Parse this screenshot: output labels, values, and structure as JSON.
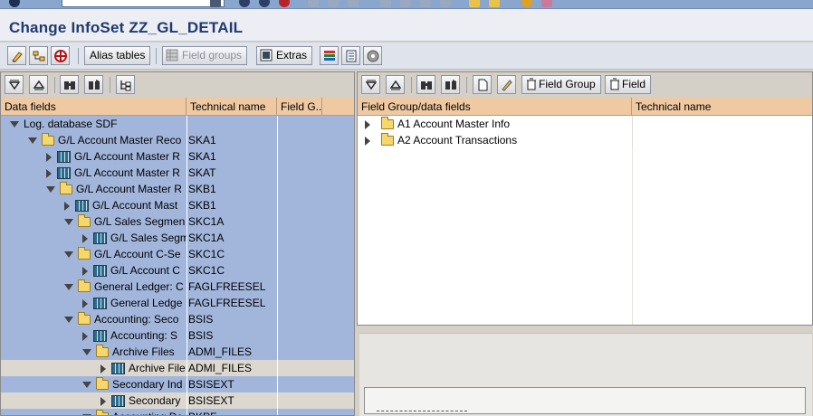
{
  "title": "Change InfoSet ZZ_GL_DETAIL",
  "app_toolbar": {
    "alias_tables": "Alias tables",
    "field_groups": "Field groups",
    "extras": "Extras"
  },
  "left": {
    "columns": [
      "Data fields",
      "Technical name",
      "Field G..."
    ],
    "rows": [
      {
        "indent": 0,
        "toggle": "down",
        "icon": "none",
        "label": "Log. database SDF",
        "tech": "",
        "style": "blue"
      },
      {
        "indent": 1,
        "toggle": "down",
        "icon": "folder",
        "label": "G/L Account Master Reco",
        "tech": "SKA1",
        "style": "blue"
      },
      {
        "indent": 2,
        "toggle": "right",
        "icon": "table",
        "label": "G/L Account Master R",
        "tech": "SKA1",
        "style": "blue"
      },
      {
        "indent": 2,
        "toggle": "right",
        "icon": "table",
        "label": "G/L Account Master R",
        "tech": "SKAT",
        "style": "blue"
      },
      {
        "indent": 2,
        "toggle": "down",
        "icon": "folder",
        "label": "G/L Account Master R",
        "tech": "SKB1",
        "style": "blue"
      },
      {
        "indent": 3,
        "toggle": "right",
        "icon": "table",
        "label": "G/L Account Mast",
        "tech": "SKB1",
        "style": "blue"
      },
      {
        "indent": 3,
        "toggle": "down",
        "icon": "folder",
        "label": "G/L Sales Segmen",
        "tech": "SKC1A",
        "style": "blue"
      },
      {
        "indent": 4,
        "toggle": "right",
        "icon": "table",
        "label": "G/L Sales Segm",
        "tech": "SKC1A",
        "style": "blue"
      },
      {
        "indent": 3,
        "toggle": "down",
        "icon": "folder",
        "label": "G/L Account C-Se",
        "tech": "SKC1C",
        "style": "blue"
      },
      {
        "indent": 4,
        "toggle": "right",
        "icon": "table",
        "label": "G/L Account C",
        "tech": "SKC1C",
        "style": "blue"
      },
      {
        "indent": 3,
        "toggle": "down",
        "icon": "folder",
        "label": "General Ledger: C",
        "tech": "FAGLFREESEL",
        "style": "blue"
      },
      {
        "indent": 4,
        "toggle": "right",
        "icon": "table",
        "label": "General Ledge",
        "tech": "FAGLFREESEL",
        "style": "blue"
      },
      {
        "indent": 3,
        "toggle": "down",
        "icon": "folder",
        "label": "Accounting: Seco",
        "tech": "BSIS",
        "style": "blue"
      },
      {
        "indent": 4,
        "toggle": "right",
        "icon": "table",
        "label": "Accounting: S",
        "tech": "BSIS",
        "style": "blue"
      },
      {
        "indent": 4,
        "toggle": "down",
        "icon": "folder",
        "label": "Archive Files",
        "tech": "ADMI_FILES",
        "style": "blue"
      },
      {
        "indent": 5,
        "toggle": "right",
        "icon": "table",
        "label": "Archive File",
        "tech": "ADMI_FILES",
        "style": "gray"
      },
      {
        "indent": 4,
        "toggle": "down",
        "icon": "folder",
        "label": "Secondary Ind",
        "tech": "BSISEXT",
        "style": "blue"
      },
      {
        "indent": 5,
        "toggle": "right",
        "icon": "table",
        "label": "Secondary",
        "tech": "BSISEXT",
        "style": "gray"
      },
      {
        "indent": 4,
        "toggle": "down",
        "icon": "folder",
        "label": "Accounting Dc",
        "tech": "BKPF",
        "style": "blue"
      }
    ]
  },
  "right": {
    "toolbar": {
      "field_group": "Field Group",
      "field": "Field"
    },
    "columns": [
      "Field Group/data fields",
      "Technical name"
    ],
    "rows": [
      {
        "label": "A1 Account Master Info"
      },
      {
        "label": "A2 Account Transactions"
      }
    ]
  }
}
